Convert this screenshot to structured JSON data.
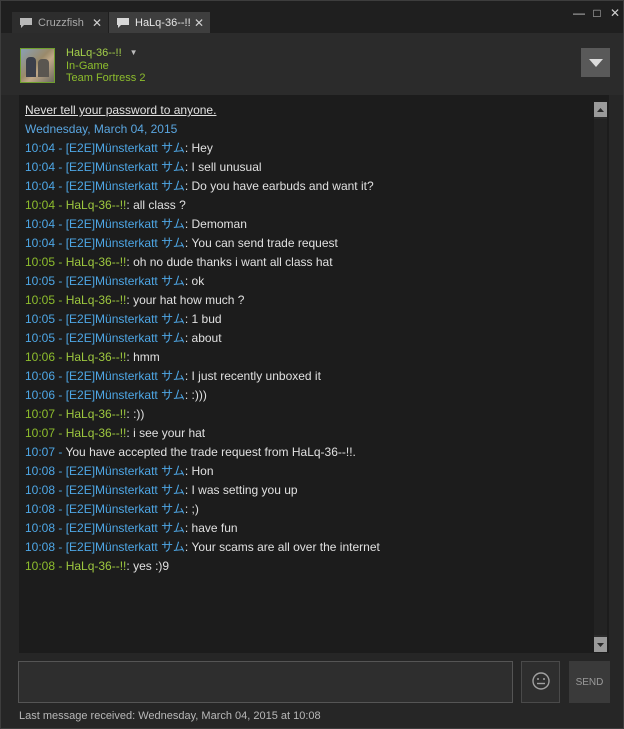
{
  "tabs": [
    {
      "label": "Cruzzfish",
      "close": "✕"
    },
    {
      "label": "HaLq-36--!!",
      "close": "✕"
    }
  ],
  "window_controls": {
    "minimize": "—",
    "maximize": "□",
    "close": "✕"
  },
  "friend": {
    "name": "HaLq-36--!!",
    "status": "In-Game",
    "game": "Team Fortress 2"
  },
  "chat": {
    "warning": "Never tell your password to anyone.",
    "date": "Wednesday, March 04, 2015",
    "messages": [
      {
        "time": "10:04",
        "sender": "[E2E]Münsterkatt サム",
        "text": "Hey",
        "mine": false
      },
      {
        "time": "10:04",
        "sender": "[E2E]Münsterkatt サム",
        "text": "I sell unusual",
        "mine": false
      },
      {
        "time": "10:04",
        "sender": "[E2E]Münsterkatt サム",
        "text": "Do you have earbuds and want it?",
        "mine": false
      },
      {
        "time": "10:04",
        "sender": "HaLq-36--!!",
        "text": "all class ?",
        "mine": true
      },
      {
        "time": "10:04",
        "sender": "[E2E]Münsterkatt サム",
        "text": "Demoman",
        "mine": false
      },
      {
        "time": "10:04",
        "sender": "[E2E]Münsterkatt サム",
        "text": "You can send trade request",
        "mine": false
      },
      {
        "time": "10:05",
        "sender": "HaLq-36--!!",
        "text": "oh no dude thanks i want all class hat",
        "mine": true
      },
      {
        "time": "10:05",
        "sender": "[E2E]Münsterkatt サム",
        "text": "ok",
        "mine": false
      },
      {
        "time": "10:05",
        "sender": "HaLq-36--!!",
        "text": "your hat how much ?",
        "mine": true
      },
      {
        "time": "10:05",
        "sender": "[E2E]Münsterkatt サム",
        "text": "1 bud",
        "mine": false
      },
      {
        "time": "10:05",
        "sender": "[E2E]Münsterkatt サム",
        "text": "about",
        "mine": false
      },
      {
        "time": "10:06",
        "sender": "HaLq-36--!!",
        "text": "hmm",
        "mine": true
      },
      {
        "time": "10:06",
        "sender": "[E2E]Münsterkatt サム",
        "text": "I just recently unboxed it",
        "mine": false
      },
      {
        "time": "10:06",
        "sender": "[E2E]Münsterkatt サム",
        "text": ":)))",
        "mine": false
      },
      {
        "time": "10:07",
        "sender": "HaLq-36--!!",
        "text": ":))",
        "mine": true
      },
      {
        "time": "10:07",
        "sender": "HaLq-36--!!",
        "text": "i see your hat",
        "mine": true
      },
      {
        "time": "10:07",
        "sender": "",
        "text": "You have accepted the trade request from HaLq-36--!!.",
        "mine": false,
        "system": true
      },
      {
        "time": "10:08",
        "sender": "[E2E]Münsterkatt サム",
        "text": "Hon",
        "mine": false
      },
      {
        "time": "10:08",
        "sender": "[E2E]Münsterkatt サム",
        "text": "I was setting you up",
        "mine": false
      },
      {
        "time": "10:08",
        "sender": "[E2E]Münsterkatt サム",
        "text": ";)",
        "mine": false
      },
      {
        "time": "10:08",
        "sender": "[E2E]Münsterkatt サム",
        "text": "have fun",
        "mine": false
      },
      {
        "time": "10:08",
        "sender": "[E2E]Münsterkatt サム",
        "text": "Your scams are all over the internet",
        "mine": false
      },
      {
        "time": "10:08",
        "sender": "HaLq-36--!!",
        "text": "yes :)9",
        "mine": true
      }
    ]
  },
  "input": {
    "value": "",
    "placeholder": ""
  },
  "send_label": "SEND",
  "footer": "Last message received: Wednesday, March 04, 2015 at 10:08",
  "colors": {
    "them": "#4ea7e6",
    "mine": "#9ec83f",
    "background": "#1c1c1c"
  },
  "icons": {
    "tab": "chat-bubble-icon",
    "dropdown": "chevron-down-icon",
    "emoji": "emoticon-icon"
  }
}
